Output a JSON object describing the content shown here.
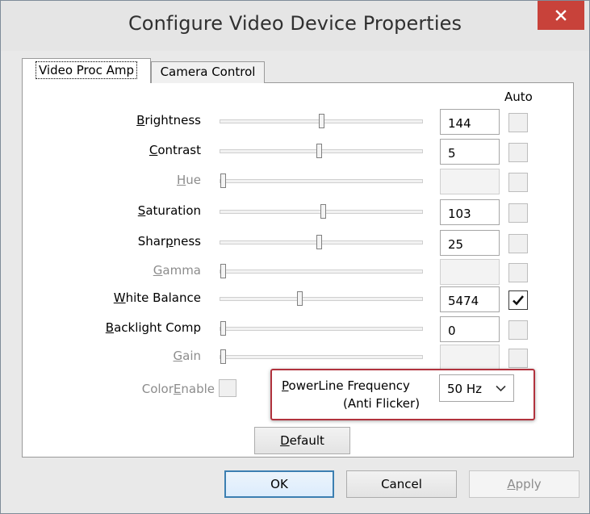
{
  "window": {
    "title": "Configure Video Device Properties"
  },
  "tabs": [
    {
      "label": "Video Proc Amp",
      "active": true
    },
    {
      "label": "Camera Control",
      "active": false
    }
  ],
  "auto_header": "Auto",
  "rows": [
    {
      "pre": "",
      "key": "B",
      "post": "rightness",
      "value": "144",
      "enabled": true,
      "slider_percent": 50,
      "auto_checked": false
    },
    {
      "pre": "",
      "key": "C",
      "post": "ontrast",
      "value": "5",
      "enabled": true,
      "slider_percent": 49,
      "auto_checked": false
    },
    {
      "pre": "",
      "key": "H",
      "post": "ue",
      "value": "",
      "enabled": false,
      "slider_percent": 0,
      "auto_checked": false
    },
    {
      "pre": "",
      "key": "S",
      "post": "aturation",
      "value": "103",
      "enabled": true,
      "slider_percent": 51,
      "auto_checked": false
    },
    {
      "pre": "Shar",
      "key": "p",
      "post": "ness",
      "value": "25",
      "enabled": true,
      "slider_percent": 49,
      "auto_checked": false
    },
    {
      "pre": "",
      "key": "G",
      "post": "amma",
      "value": "",
      "enabled": false,
      "slider_percent": 0,
      "auto_checked": false
    },
    {
      "pre": "",
      "key": "W",
      "post": "hite Balance",
      "value": "5474",
      "enabled": true,
      "slider_percent": 39,
      "auto_checked": true
    },
    {
      "pre": "",
      "key": "B",
      "post": "acklight Comp",
      "value": "0",
      "enabled": true,
      "slider_percent": 0,
      "auto_checked": false
    },
    {
      "pre": "",
      "key": "G",
      "post": "ain",
      "value": "",
      "enabled": false,
      "slider_percent": 0,
      "auto_checked": false
    }
  ],
  "color_enable": {
    "pre": "Color",
    "key": "E",
    "post": "nable",
    "checked": false
  },
  "powerline": {
    "pre": "",
    "key": "P",
    "post": "owerLine Frequency",
    "line2": "(Anti Flicker)",
    "selected": "50 Hz"
  },
  "buttons": {
    "default": {
      "pre": "",
      "key": "D",
      "post": "efault"
    },
    "ok": "OK",
    "cancel": "Cancel",
    "apply": {
      "pre": "",
      "key": "A",
      "post": "pply"
    }
  },
  "colors": {
    "close_button": "#c8423a",
    "highlight_border": "#b1323d",
    "focus_border": "#3c7fb1"
  }
}
